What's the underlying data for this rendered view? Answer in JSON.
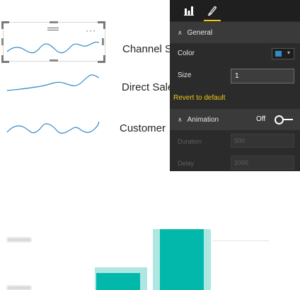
{
  "sparklines": [
    {
      "label": "Channel S",
      "color": "#2f8cc7"
    },
    {
      "label": "Direct Sale",
      "color": "#2f8cc7"
    },
    {
      "label": "Customer",
      "color": "#2f8cc7"
    }
  ],
  "visual_header": {
    "more_icon": "more-icon",
    "grip_icon": "grip-icon"
  },
  "format_pane": {
    "tabs": [
      {
        "name": "fields",
        "icon": "bar-chart-icon"
      },
      {
        "name": "format",
        "icon": "paint-brush-icon",
        "active": true
      }
    ],
    "general": {
      "title": "General",
      "color_label": "Color",
      "color_value": "#2f8cc7",
      "size_label": "Size",
      "size_value": "1",
      "revert": "Revert to default"
    },
    "animation": {
      "title": "Animation",
      "toggle_state": "Off",
      "duration_label": "Duration",
      "duration_value": "500",
      "delay_label": "Delay",
      "delay_value": "2000"
    },
    "accent_color": "#f2c811",
    "bg_color": "#2b2b2b"
  },
  "bar_colors": {
    "bar": "#01b8aa",
    "halo": "#aee6e1"
  }
}
